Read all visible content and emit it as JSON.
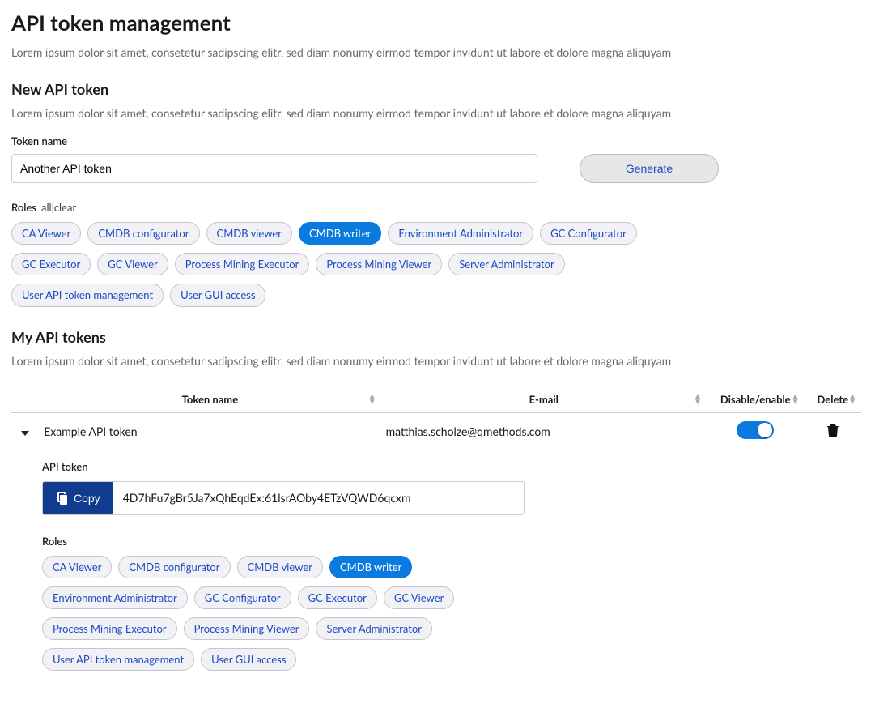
{
  "page": {
    "title": "API token management",
    "subtitle": "Lorem ipsum dolor sit amet, consetetur sadipscing elitr, sed diam nonumy eirmod tempor invidunt ut labore et dolore magna aliquyam"
  },
  "newToken": {
    "heading": "New API token",
    "subtitle": "Lorem ipsum dolor sit amet, consetetur sadipscing elitr, sed diam nonumy eirmod tempor invidunt ut labore et dolore magna aliquyam",
    "tokenNameLabel": "Token name",
    "tokenNameValue": "Another API token",
    "generateLabel": "Generate",
    "rolesLabel": "Roles",
    "rolesLinksText": "all|clear",
    "roles": [
      {
        "label": "CA Viewer",
        "selected": false
      },
      {
        "label": "CMDB configurator",
        "selected": false
      },
      {
        "label": "CMDB viewer",
        "selected": false
      },
      {
        "label": "CMDB writer",
        "selected": true
      },
      {
        "label": "Environment Administrator",
        "selected": false
      },
      {
        "label": "GC Configurator",
        "selected": false
      },
      {
        "label": "GC Executor",
        "selected": false
      },
      {
        "label": "GC Viewer",
        "selected": false
      },
      {
        "label": "Process Mining Executor",
        "selected": false
      },
      {
        "label": "Process Mining Viewer",
        "selected": false
      },
      {
        "label": "Server Administrator",
        "selected": false
      },
      {
        "label": "User API token management",
        "selected": false
      },
      {
        "label": "User GUI access",
        "selected": false
      }
    ]
  },
  "myTokens": {
    "heading": "My API tokens",
    "subtitle": "Lorem ipsum dolor sit amet, consetetur sadipscing elitr, sed diam nonumy eirmod tempor invidunt ut labore et dolore magna aliquyam",
    "columns": {
      "name": "Token name",
      "email": "E-mail",
      "toggle": "Disable/enable",
      "del": "Delete"
    },
    "rows": [
      {
        "name": "Example API token",
        "email": "matthias.scholze@qmethods.com",
        "enabled": true,
        "expanded": true,
        "detail": {
          "apiTokenLabel": "API token",
          "copyLabel": "Copy",
          "tokenValue": "4D7hFu7gBr5Ja7xQhEqdEx:61lsrAOby4ETzVQWD6qcxm",
          "rolesLabel": "Roles",
          "roles": [
            {
              "label": "CA Viewer",
              "selected": false
            },
            {
              "label": "CMDB configurator",
              "selected": false
            },
            {
              "label": "CMDB viewer",
              "selected": false
            },
            {
              "label": "CMDB writer",
              "selected": true
            },
            {
              "label": "Environment Administrator",
              "selected": false
            },
            {
              "label": "GC Configurator",
              "selected": false
            },
            {
              "label": "GC Executor",
              "selected": false
            },
            {
              "label": "GC Viewer",
              "selected": false
            },
            {
              "label": "Process Mining Executor",
              "selected": false
            },
            {
              "label": "Process Mining Viewer",
              "selected": false
            },
            {
              "label": "Server Administrator",
              "selected": false
            },
            {
              "label": "User API token management",
              "selected": false
            },
            {
              "label": "User GUI access",
              "selected": false
            }
          ]
        }
      }
    ]
  }
}
